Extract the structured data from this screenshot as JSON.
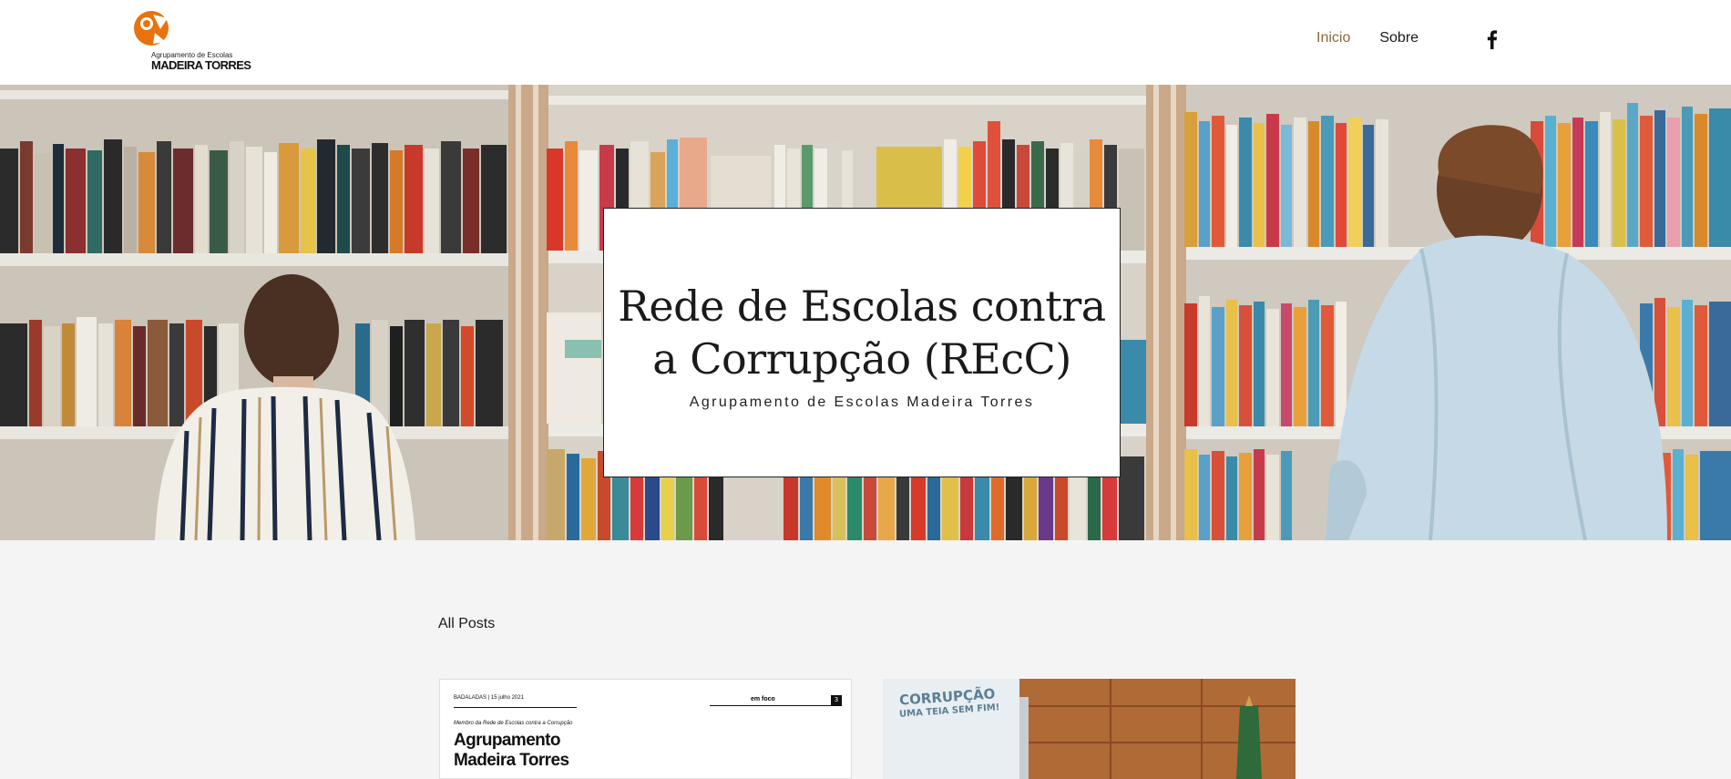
{
  "brand": {
    "logo_line1": "Agrupamento de Escolas",
    "logo_line2": "MADEIRA TORRES",
    "accent_color": "#e8730c"
  },
  "nav": {
    "items": [
      {
        "label": "Inicio",
        "active": true
      },
      {
        "label": "Sobre",
        "active": false
      }
    ],
    "social_icon": "facebook-icon"
  },
  "hero": {
    "title": "Rede de Escolas contra a Corrupção (REcC)",
    "subtitle": "Agrupamento de Escolas Madeira Torres"
  },
  "posts": {
    "heading": "All Posts",
    "cards": [
      {
        "header_text": "BADALADAS | 15 julho 2021",
        "section_label": "em foco",
        "page_number": "3",
        "tagline": "Membro da Rede de Escolas contra a Corrupção",
        "title_line1": "Agrupamento",
        "title_line2": "Madeira Torres"
      },
      {
        "poster_line1": "CORRUPÇÃO",
        "poster_line2": "UMA TEIA SEM FIM!"
      }
    ]
  }
}
